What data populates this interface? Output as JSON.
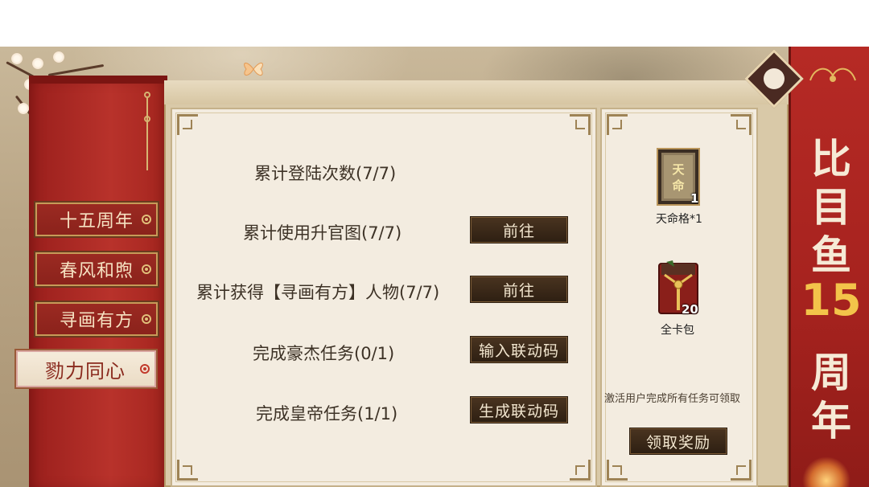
{
  "tabs": [
    {
      "label": "十五周年",
      "active": false
    },
    {
      "label": "春风和煦",
      "active": false
    },
    {
      "label": "寻画有方",
      "active": false
    },
    {
      "label": "勠力同心",
      "active": true
    }
  ],
  "tasks": [
    {
      "text": "累计登陆次数(7/7)",
      "button": null
    },
    {
      "text": "累计使用升官图(7/7)",
      "button": "前往"
    },
    {
      "text": "累计获得【寻画有方】人物(7/7)",
      "button": "前往"
    },
    {
      "text": "完成豪杰任务(0/1)",
      "button": "输入联动码"
    },
    {
      "text": "完成皇帝任务(1/1)",
      "button": "生成联动码"
    }
  ],
  "rewards": [
    {
      "name": "天命格*1",
      "count": "1",
      "icon": "tianming-card-icon"
    },
    {
      "name": "全卡包",
      "count": "20",
      "icon": "card-pack-icon"
    }
  ],
  "reward_note": "激活用户完成所有任务可领取",
  "claim_button": "领取奖励",
  "banner": {
    "chars": [
      "比",
      "目",
      "鱼"
    ],
    "number": "15",
    "chars2": [
      "周",
      "年"
    ]
  },
  "card_icon_text": "天命",
  "colors": {
    "accent_red": "#b62a25",
    "button_dark": "#2d1f12",
    "gold": "#f3c34a"
  }
}
